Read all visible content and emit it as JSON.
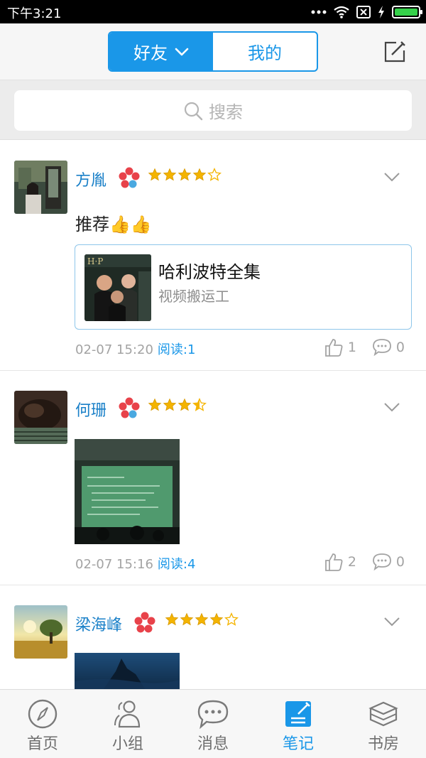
{
  "status_bar": {
    "time": "下午3:21"
  },
  "header": {
    "tabs": [
      {
        "label": "好友",
        "active": true
      },
      {
        "label": "我的",
        "active": false
      }
    ],
    "edit_icon": "compose-icon"
  },
  "search": {
    "placeholder": "搜索"
  },
  "posts": [
    {
      "user": "方胤",
      "rating": 4,
      "text": "推荐👍👍",
      "card": {
        "title": "哈利波特全集",
        "subtitle": "视频搬运工"
      },
      "time": "02-07 15:20",
      "reads": "阅读:1",
      "likes": "1",
      "comments": "0"
    },
    {
      "user": "何珊",
      "rating": 3.5,
      "time": "02-07 15:16",
      "reads": "阅读:4",
      "likes": "2",
      "comments": "0"
    },
    {
      "user": "梁海峰",
      "rating": 4
    }
  ],
  "tabbar": [
    {
      "label": "首页",
      "icon": "compass-icon",
      "active": false
    },
    {
      "label": "小组",
      "icon": "group-icon",
      "active": false
    },
    {
      "label": "消息",
      "icon": "chat-icon",
      "active": false
    },
    {
      "label": "笔记",
      "icon": "note-icon",
      "active": true
    },
    {
      "label": "书房",
      "icon": "books-icon",
      "active": false
    }
  ],
  "colors": {
    "accent": "#1a97e8",
    "username": "#1a80c8",
    "star": "#f4b400",
    "badge": "#e8424a"
  }
}
